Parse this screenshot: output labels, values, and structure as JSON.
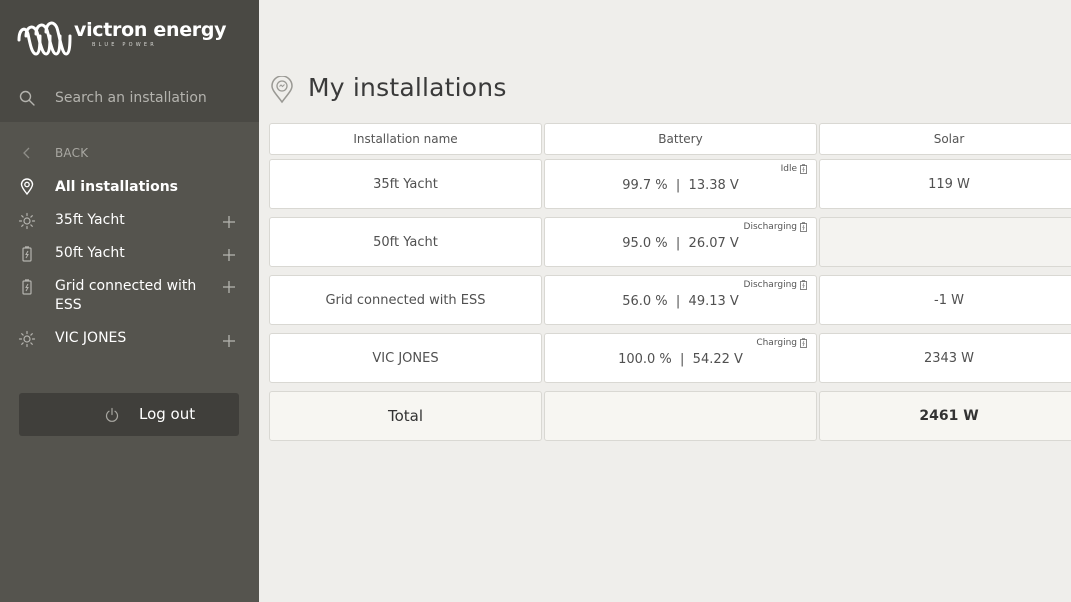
{
  "brand": {
    "name": "victron energy",
    "tagline": "BLUE POWER"
  },
  "search": {
    "placeholder": "Search an installation"
  },
  "nav": {
    "back_label": "BACK",
    "items": [
      {
        "label": "All installations",
        "icon": "location-pin-icon",
        "active": true,
        "expandable": false
      },
      {
        "label": "35ft Yacht",
        "icon": "sun-icon",
        "expandable": true
      },
      {
        "label": "50ft Yacht",
        "icon": "battery-icon",
        "expandable": true
      },
      {
        "label": "Grid connected with ESS",
        "icon": "battery-icon",
        "expandable": true
      },
      {
        "label": "VIC JONES",
        "icon": "sun-icon",
        "expandable": true
      }
    ],
    "logout_label": "Log out"
  },
  "page": {
    "title": "My installations"
  },
  "table": {
    "headers": [
      "Installation name",
      "Battery",
      "Solar"
    ],
    "rows": [
      {
        "name": "35ft Yacht",
        "battery": "99.7 %  |  13.38 V",
        "state": "Idle",
        "solar": "119 W"
      },
      {
        "name": "50ft Yacht",
        "battery": "95.0 %  |  26.07 V",
        "state": "Discharging",
        "solar": ""
      },
      {
        "name": "Grid connected with ESS",
        "battery": "56.0 %  |  49.13 V",
        "state": "Discharging",
        "solar": "-1 W"
      },
      {
        "name": "VIC JONES",
        "battery": "100.0 %  |  54.22 V",
        "state": "Charging",
        "solar": "2343 W"
      }
    ],
    "total": {
      "label": "Total",
      "battery": "",
      "solar": "2461 W"
    }
  },
  "colors": {
    "sidebar_dark": "#4a4944",
    "sidebar_nav": "#55544e",
    "logout_bg": "#403f3b",
    "main_bg": "#efeeeb"
  }
}
